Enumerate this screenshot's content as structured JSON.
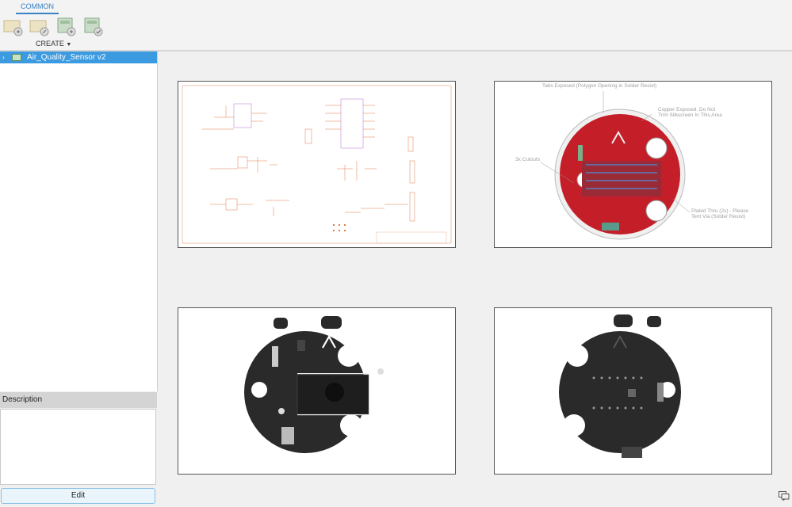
{
  "toolbar": {
    "tab_common": "COMMON",
    "create_label": "CREATE",
    "tools": [
      "new-design-icon",
      "new-design-linked-icon",
      "new-library-icon",
      "derive-icon"
    ]
  },
  "tree": {
    "items": [
      {
        "label": "Air_Quality_Sensor v2"
      }
    ]
  },
  "description": {
    "header": "Description",
    "text": ""
  },
  "edit_label": "Edit",
  "thumbnails": {
    "pcb_top": {
      "annotations": {
        "tabs": "Tabs Exposed (Polygon Opening in Solder Resist)",
        "copper1": "Copper Exposed, Do Not",
        "copper2": "Trim Silkscreen In This Area",
        "cutouts": "3x Cutouts",
        "plated1": "Plated Thru (2x) - Please",
        "plated2": "Tent Via (Solder Resist)"
      }
    }
  },
  "colors": {
    "accent": "#3a82c4",
    "selection": "#3b9ae0",
    "pcb_red": "#c41e28",
    "board": "#2a2a2a"
  }
}
